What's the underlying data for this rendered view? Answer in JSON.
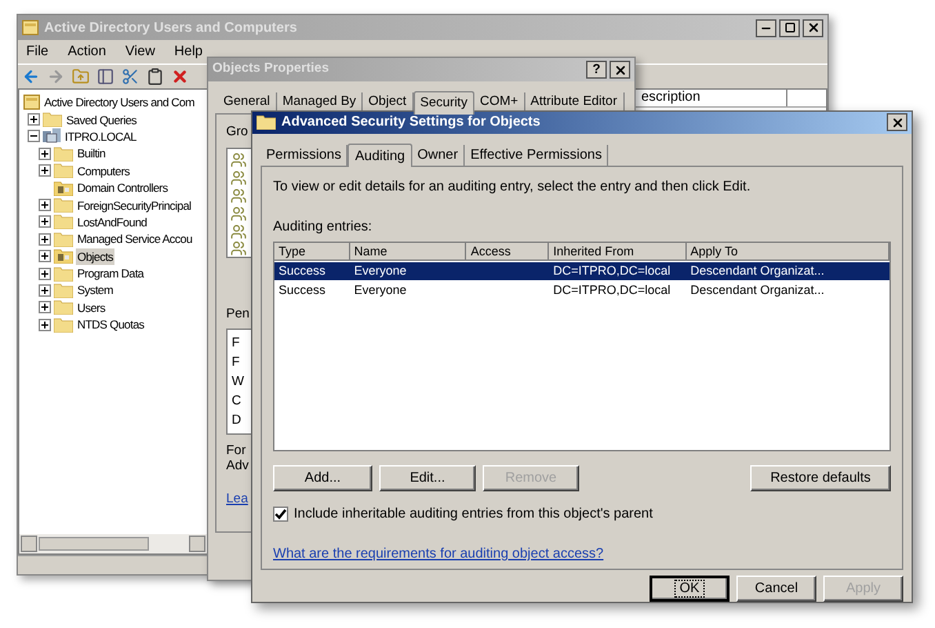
{
  "main_window": {
    "title": "Active Directory Users and Computers",
    "menu": [
      "File",
      "Action",
      "View",
      "Help"
    ],
    "tree": [
      {
        "label": "Active Directory Users and Com",
        "kind": "root",
        "selected": false,
        "children": [
          {
            "label": "Saved Queries",
            "kind": "folder",
            "expanded": false,
            "selected": false
          },
          {
            "label": "ITPRO.LOCAL",
            "kind": "domain",
            "expanded": true,
            "selected": false,
            "children": [
              {
                "label": "Builtin",
                "kind": "folder",
                "expanded": false,
                "selected": false
              },
              {
                "label": "Computers",
                "kind": "folder",
                "expanded": false,
                "selected": false
              },
              {
                "label": "Domain Controllers",
                "kind": "ou",
                "selected": false
              },
              {
                "label": "ForeignSecurityPrincipal",
                "kind": "folder",
                "expanded": false,
                "selected": false
              },
              {
                "label": "LostAndFound",
                "kind": "folder",
                "expanded": false,
                "selected": false
              },
              {
                "label": "Managed Service Accou",
                "kind": "folder",
                "expanded": false,
                "selected": false
              },
              {
                "label": "Objects",
                "kind": "ou",
                "expanded": false,
                "selected": true
              },
              {
                "label": "Program Data",
                "kind": "folder",
                "expanded": false,
                "selected": false
              },
              {
                "label": "System",
                "kind": "folder",
                "expanded": false,
                "selected": false
              },
              {
                "label": "Users",
                "kind": "folder",
                "expanded": false,
                "selected": false
              },
              {
                "label": "NTDS Quotas",
                "kind": "folder",
                "expanded": false,
                "selected": false
              }
            ]
          }
        ]
      }
    ],
    "list_column": "escription"
  },
  "properties": {
    "title": "Objects Properties",
    "help_button": "?",
    "tabs": [
      {
        "label": "General",
        "selected": false
      },
      {
        "label": "Managed By",
        "selected": false
      },
      {
        "label": "Object",
        "selected": false
      },
      {
        "label": "Security",
        "selected": true
      },
      {
        "label": "COM+",
        "selected": false
      },
      {
        "label": "Attribute Editor",
        "selected": false
      }
    ],
    "group_label": "Gro",
    "permissions_label": "Pen",
    "permission_rows": [
      "F",
      "F",
      "W",
      "C",
      "D"
    ],
    "note_lines": [
      "For",
      "Adv"
    ],
    "link": "Lea"
  },
  "advanced": {
    "title": "Advanced Security Settings for Objects",
    "tabs": [
      {
        "label": "Permissions",
        "selected": false
      },
      {
        "label": "Auditing",
        "selected": true
      },
      {
        "label": "Owner",
        "selected": false
      },
      {
        "label": "Effective Permissions",
        "selected": false
      }
    ],
    "instructions": "To view or edit details for an auditing entry, select the entry and then click Edit.",
    "entries_label": "Auditing entries:",
    "columns": [
      "Type",
      "Name",
      "Access",
      "Inherited From",
      "Apply To"
    ],
    "rows": [
      {
        "cells": [
          "Success",
          "Everyone",
          "",
          "DC=ITPRO,DC=local",
          "Descendant Organizat..."
        ],
        "selected": true
      },
      {
        "cells": [
          "Success",
          "Everyone",
          "",
          "DC=ITPRO,DC=local",
          "Descendant Organizat..."
        ],
        "selected": false
      }
    ],
    "buttons": [
      {
        "label": "Add...",
        "disabled": false
      },
      {
        "label": "Edit...",
        "disabled": false
      },
      {
        "label": "Remove",
        "disabled": true
      }
    ],
    "restore_button": "Restore defaults",
    "checkbox": {
      "label": "Include inheritable auditing entries from this object's parent",
      "checked": true
    },
    "link": "What are the requirements for auditing object access?",
    "footer_buttons": [
      {
        "label": "OK",
        "disabled": false,
        "focused": true
      },
      {
        "label": "Cancel",
        "disabled": false,
        "focused": false
      },
      {
        "label": "Apply",
        "disabled": true,
        "focused": false
      }
    ]
  }
}
